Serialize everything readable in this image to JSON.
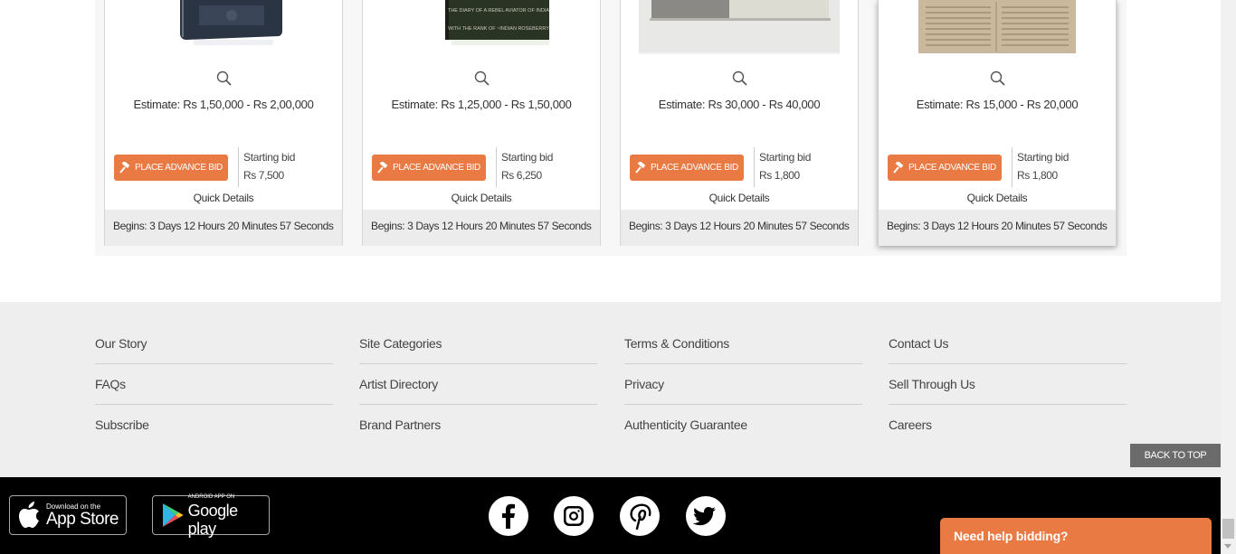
{
  "lots": [
    {
      "estimate": "Estimate: Rs 1,50,000 - Rs 2,00,000",
      "bid_label": "PLACE ADVANCE BID",
      "starting_label": "Starting bid",
      "starting_value": "Rs 7,500",
      "quick_details": "Quick Details",
      "countdown": "Begins: 3 Days 12 Hours 20 Minutes 57 Seconds"
    },
    {
      "estimate": "Estimate: Rs 1,25,000 - Rs 1,50,000",
      "bid_label": "PLACE ADVANCE BID",
      "starting_label": "Starting bid",
      "starting_value": "Rs 6,250",
      "quick_details": "Quick Details",
      "countdown": "Begins: 3 Days 12 Hours 20 Minutes 57 Seconds",
      "cover_text_1": "THE DIARY OF A REBEL AVIATOR OF INDIA",
      "cover_text_2": "WITH THE RANK OF ~INDIAN ROSEBERRY"
    },
    {
      "estimate": "Estimate: Rs 30,000 - Rs 40,000",
      "bid_label": "PLACE ADVANCE BID",
      "starting_label": "Starting bid",
      "starting_value": "Rs 1,800",
      "quick_details": "Quick Details",
      "countdown": "Begins: 3 Days 12 Hours 20 Minutes 57 Seconds"
    },
    {
      "estimate": "Estimate: Rs 15,000 - Rs 20,000",
      "bid_label": "PLACE ADVANCE BID",
      "starting_label": "Starting bid",
      "starting_value": "Rs 1,800",
      "quick_details": "Quick Details",
      "countdown": "Begins: 3 Days 12 Hours 20 Minutes 57 Seconds"
    }
  ],
  "footer": {
    "columns": [
      [
        "Our Story",
        "FAQs",
        "Subscribe"
      ],
      [
        "Site Categories",
        "Artist Directory",
        "Brand Partners"
      ],
      [
        "Terms & Conditions",
        "Privacy",
        "Authenticity Guarantee"
      ],
      [
        "Contact Us",
        "Sell Through Us",
        "Careers"
      ]
    ],
    "back_to_top": "BACK TO TOP"
  },
  "apps": {
    "app_store_small": "Download on the",
    "app_store_big": "App Store",
    "google_small": "ANDROID APP ON",
    "google_big": "Google play"
  },
  "social_icons": [
    "facebook-icon",
    "instagram-icon",
    "pinterest-icon",
    "twitter-icon"
  ],
  "help": {
    "label": "Need help bidding?"
  },
  "colors": {
    "accent": "#ea7a43",
    "footer_bg": "#eeeeee",
    "footer_black": "#000000",
    "back_to_top": "#6b6b6b"
  }
}
